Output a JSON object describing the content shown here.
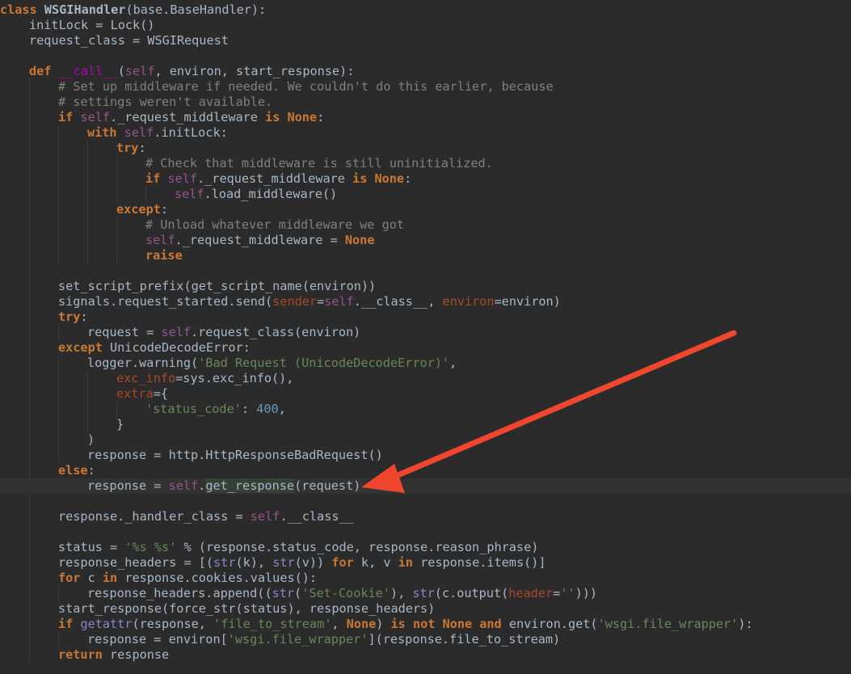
{
  "editor": {
    "language": "python",
    "highlighted_symbol": "get_response",
    "colors": {
      "background": "#2b2b2b",
      "keyword": "#cc7832",
      "self": "#94558d",
      "comment": "#808080",
      "string": "#6a8759",
      "number": "#6897bb",
      "parameter": "#aa4926",
      "magic_method": "#b200b2",
      "builtin": "#8888c6",
      "default_text": "#a9b7c6",
      "annotation_arrow": "#f0462d"
    },
    "lines": [
      {
        "indent": 0,
        "tokens": [
          [
            "kw",
            "class "
          ],
          [
            "cls",
            "WSGIHandler"
          ],
          [
            "",
            "(base.BaseHandler):"
          ]
        ]
      },
      {
        "indent": 1,
        "tokens": [
          [
            "",
            "initLock = Lock()"
          ]
        ]
      },
      {
        "indent": 1,
        "tokens": [
          [
            "",
            "request_class = WSGIRequest"
          ]
        ]
      },
      {
        "indent": 0,
        "tokens": []
      },
      {
        "indent": 1,
        "tokens": [
          [
            "kw",
            "def "
          ],
          [
            "magic",
            "__call__"
          ],
          [
            "",
            "("
          ],
          [
            "self",
            "self"
          ],
          [
            "",
            ", environ, start_response):"
          ]
        ]
      },
      {
        "indent": 2,
        "tokens": [
          [
            "cm",
            "# Set up middleware if needed. We couldn't do this earlier, because"
          ]
        ]
      },
      {
        "indent": 2,
        "tokens": [
          [
            "cm",
            "# settings weren't available."
          ]
        ]
      },
      {
        "indent": 2,
        "tokens": [
          [
            "kw",
            "if "
          ],
          [
            "self",
            "self"
          ],
          [
            "",
            "._request_middleware "
          ],
          [
            "kw",
            "is None"
          ],
          [
            "",
            ":"
          ]
        ]
      },
      {
        "indent": 3,
        "tokens": [
          [
            "kw",
            "with "
          ],
          [
            "self",
            "self"
          ],
          [
            "",
            ".initLock:"
          ]
        ]
      },
      {
        "indent": 4,
        "tokens": [
          [
            "kw",
            "try"
          ],
          [
            "",
            ":"
          ]
        ]
      },
      {
        "indent": 5,
        "tokens": [
          [
            "cm",
            "# Check that middleware is still uninitialized."
          ]
        ]
      },
      {
        "indent": 5,
        "tokens": [
          [
            "kw",
            "if "
          ],
          [
            "self",
            "self"
          ],
          [
            "",
            "._request_middleware "
          ],
          [
            "kw",
            "is None"
          ],
          [
            "",
            ":"
          ]
        ]
      },
      {
        "indent": 6,
        "tokens": [
          [
            "self",
            "self"
          ],
          [
            "",
            ".load_middleware()"
          ]
        ]
      },
      {
        "indent": 4,
        "tokens": [
          [
            "kw",
            "except"
          ],
          [
            "",
            ":"
          ]
        ]
      },
      {
        "indent": 5,
        "tokens": [
          [
            "cm",
            "# Unload whatever middleware we got"
          ]
        ]
      },
      {
        "indent": 5,
        "tokens": [
          [
            "self",
            "self"
          ],
          [
            "",
            "._request_middleware = "
          ],
          [
            "kw",
            "None"
          ]
        ]
      },
      {
        "indent": 5,
        "tokens": [
          [
            "kw",
            "raise"
          ]
        ]
      },
      {
        "indent": 0,
        "tokens": []
      },
      {
        "indent": 2,
        "tokens": [
          [
            "",
            "set_script_prefix(get_script_name(environ))"
          ]
        ]
      },
      {
        "indent": 2,
        "tokens": [
          [
            "",
            "signals.request_started.send("
          ],
          [
            "param",
            "sender"
          ],
          [
            "",
            "="
          ],
          [
            "self",
            "self"
          ],
          [
            "",
            ".__class__, "
          ],
          [
            "param",
            "environ"
          ],
          [
            "",
            "=environ)"
          ]
        ]
      },
      {
        "indent": 2,
        "tokens": [
          [
            "kw",
            "try"
          ],
          [
            "",
            ":"
          ]
        ]
      },
      {
        "indent": 3,
        "tokens": [
          [
            "",
            "request = "
          ],
          [
            "self",
            "self"
          ],
          [
            "",
            ".request_class(environ)"
          ]
        ]
      },
      {
        "indent": 2,
        "tokens": [
          [
            "kw",
            "except "
          ],
          [
            "",
            "UnicodeDecodeError:"
          ]
        ]
      },
      {
        "indent": 3,
        "tokens": [
          [
            "",
            "logger.warning("
          ],
          [
            "str",
            "'Bad Request (UnicodeDecodeError)'"
          ],
          [
            "",
            ","
          ]
        ]
      },
      {
        "indent": 4,
        "tokens": [
          [
            "param",
            "exc_info"
          ],
          [
            "",
            "=sys.exc_info(),"
          ]
        ]
      },
      {
        "indent": 4,
        "tokens": [
          [
            "param",
            "extra"
          ],
          [
            "",
            "={"
          ]
        ]
      },
      {
        "indent": 5,
        "tokens": [
          [
            "str",
            "'status_code'"
          ],
          [
            "",
            ": "
          ],
          [
            "num",
            "400"
          ],
          [
            "",
            ","
          ]
        ]
      },
      {
        "indent": 4,
        "tokens": [
          [
            "",
            "}"
          ]
        ]
      },
      {
        "indent": 3,
        "tokens": [
          [
            "",
            ")"
          ]
        ]
      },
      {
        "indent": 3,
        "tokens": [
          [
            "",
            "response = http.HttpResponseBadRequest()"
          ]
        ]
      },
      {
        "indent": 2,
        "tokens": [
          [
            "kw",
            "else"
          ],
          [
            "",
            ":"
          ]
        ]
      },
      {
        "indent": 3,
        "current": true,
        "tokens": [
          [
            "",
            "response = "
          ],
          [
            "self",
            "self"
          ],
          [
            "",
            "."
          ],
          [
            "hl",
            "get_response"
          ],
          [
            "",
            "(request)"
          ]
        ]
      },
      {
        "indent": 0,
        "tokens": []
      },
      {
        "indent": 2,
        "tokens": [
          [
            "",
            "response._handler_class = "
          ],
          [
            "self",
            "self"
          ],
          [
            "",
            ".__class__"
          ]
        ]
      },
      {
        "indent": 0,
        "tokens": []
      },
      {
        "indent": 2,
        "tokens": [
          [
            "",
            "status = "
          ],
          [
            "str",
            "'%s %s'"
          ],
          [
            "",
            " % (response.status_code, response.reason_phrase)"
          ]
        ]
      },
      {
        "indent": 2,
        "tokens": [
          [
            "",
            "response_headers = [("
          ],
          [
            "builtin",
            "str"
          ],
          [
            "",
            "(k), "
          ],
          [
            "builtin",
            "str"
          ],
          [
            "",
            "(v)) "
          ],
          [
            "kw",
            "for "
          ],
          [
            "",
            "k, v "
          ],
          [
            "kw",
            "in "
          ],
          [
            "",
            "response.items()]"
          ]
        ]
      },
      {
        "indent": 2,
        "tokens": [
          [
            "kw",
            "for "
          ],
          [
            "",
            "c "
          ],
          [
            "kw",
            "in "
          ],
          [
            "",
            "response.cookies.values():"
          ]
        ]
      },
      {
        "indent": 3,
        "tokens": [
          [
            "",
            "response_headers.append(("
          ],
          [
            "builtin",
            "str"
          ],
          [
            "",
            "("
          ],
          [
            "str",
            "'Set-Cookie'"
          ],
          [
            "",
            "), "
          ],
          [
            "builtin",
            "str"
          ],
          [
            "",
            "(c.output("
          ],
          [
            "param",
            "header"
          ],
          [
            "",
            "="
          ],
          [
            "str",
            "''"
          ],
          [
            "",
            ")))"
          ]
        ]
      },
      {
        "indent": 2,
        "tokens": [
          [
            "",
            "start_response(force_str(status), response_headers)"
          ]
        ]
      },
      {
        "indent": 2,
        "tokens": [
          [
            "kw",
            "if "
          ],
          [
            "builtin",
            "getattr"
          ],
          [
            "",
            "(response, "
          ],
          [
            "str",
            "'file_to_stream'"
          ],
          [
            "",
            ", "
          ],
          [
            "kw",
            "None"
          ],
          [
            "",
            ") "
          ],
          [
            "kw",
            "is not None and "
          ],
          [
            "",
            "environ.get("
          ],
          [
            "str",
            "'wsgi.file_wrapper'"
          ],
          [
            "",
            "):"
          ]
        ]
      },
      {
        "indent": 3,
        "tokens": [
          [
            "",
            "response = environ["
          ],
          [
            "str",
            "'wsgi.file_wrapper'"
          ],
          [
            "",
            "](response.file_to_stream)"
          ]
        ]
      },
      {
        "indent": 2,
        "tokens": [
          [
            "kw",
            "return "
          ],
          [
            "",
            "response"
          ]
        ]
      }
    ]
  }
}
